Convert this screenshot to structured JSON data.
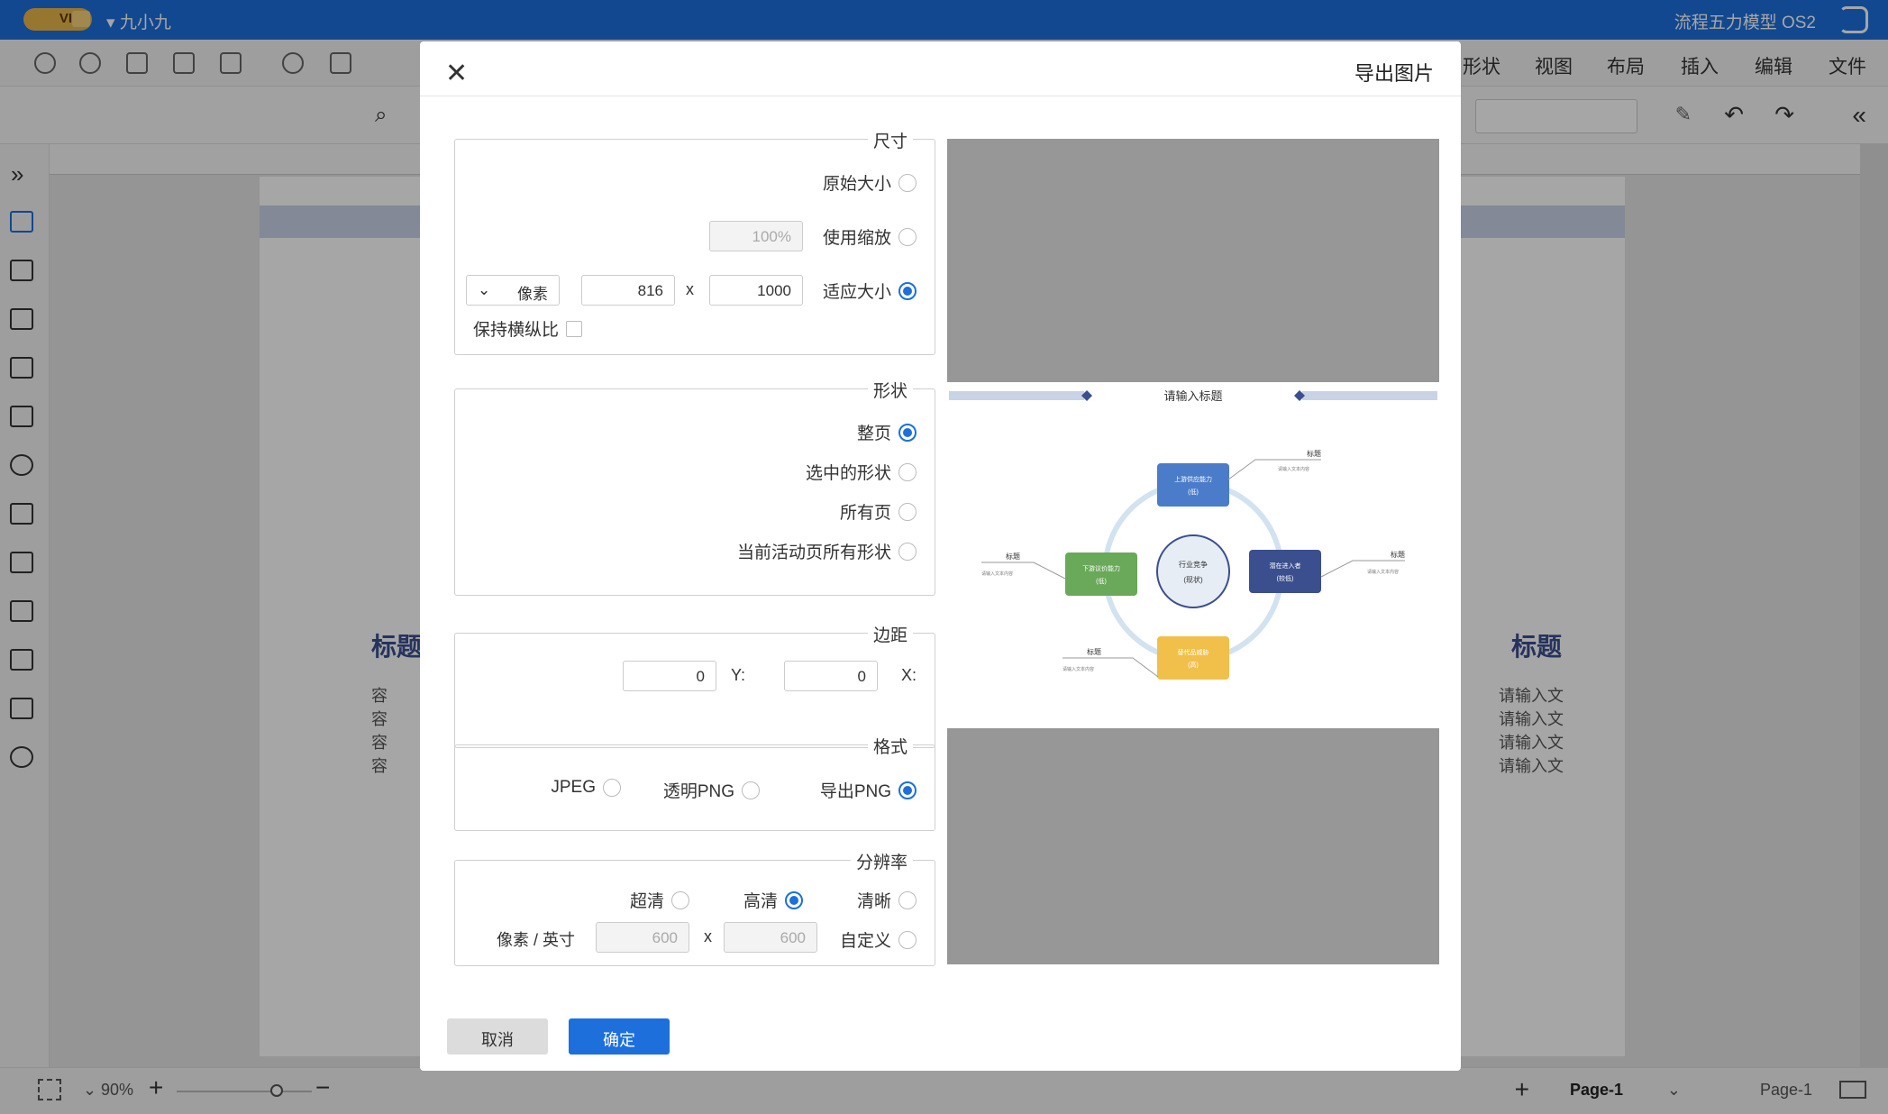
{
  "app": {
    "title": "流程五力模型 OS2",
    "user": "九小九",
    "vip": "VIP"
  },
  "menu": [
    "文件",
    "编辑",
    "插入",
    "布局",
    "视图",
    "形状"
  ],
  "status": {
    "page_tab_1": "Page-1",
    "page_tab_2": "Page-1",
    "zoom": "90%"
  },
  "background_page": {
    "title_left": "标题",
    "title_right": "标题",
    "lines_left": [
      "本内容",
      "本内容",
      "本内容",
      "本内容"
    ],
    "lines_right": [
      "请输入文",
      "请输入文",
      "请输入文",
      "请输入文"
    ],
    "lines_right_prefix": [
      "容",
      "容",
      "容",
      "容"
    ]
  },
  "dialog": {
    "title": "导出图片",
    "size": {
      "legend": "尺寸",
      "original": "原始大小",
      "use_zoom": "使用缩放",
      "zoom_value": "100%",
      "fit": "适应大小",
      "width": "1000",
      "height": "816",
      "x": "x",
      "unit": "像素",
      "keep_ratio": "保持横纵比"
    },
    "shape": {
      "legend": "形状",
      "options": [
        "整页",
        "选中的形状",
        "所有页",
        "当前活动页所有形状"
      ]
    },
    "margin": {
      "legend": "边距",
      "x_label": "X:",
      "x_value": "0",
      "y_label": "Y:",
      "y_value": "0"
    },
    "format": {
      "legend": "格式",
      "options": [
        "导出PNG",
        "透明PNG",
        "JPEG"
      ]
    },
    "resolution": {
      "legend": "分辨率",
      "options": [
        "清晰",
        "高清",
        "超清"
      ],
      "custom": "自定义",
      "custom_w": "600",
      "custom_h": "600",
      "x": "x",
      "unit": "像素 / 英寸"
    },
    "ok": "确定",
    "cancel": "取消"
  },
  "preview": {
    "heading": "请输入标题",
    "center": "行业竞争",
    "center_sub": "(现状)",
    "node_top": "上游供应能力",
    "node_right": "潜在进入者",
    "node_bottom": "替代品威胁",
    "node_left": "下游议价能力",
    "node_top_sub": "(低)",
    "node_right_sub": "(较低)",
    "node_bottom_sub": "(高)",
    "node_left_sub": "(低)",
    "label": "标题",
    "label_text": "请输入文本内容"
  },
  "colors": {
    "brand": "#1d6fdc",
    "node_top": "#4a7cc9",
    "node_right": "#3b4f8f",
    "node_bottom": "#f0c04a",
    "node_left": "#6aa85a"
  }
}
